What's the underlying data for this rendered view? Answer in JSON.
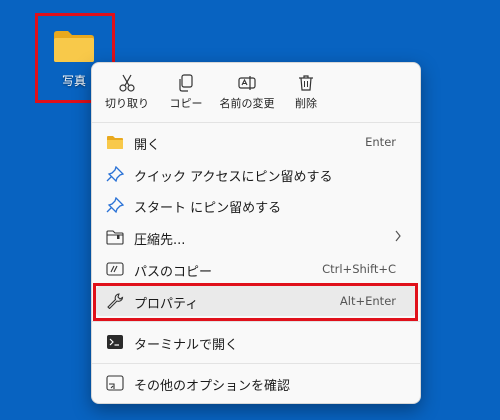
{
  "desktop": {
    "folder_label": "写真"
  },
  "quick_actions": {
    "cut": "切り取り",
    "copy": "コピー",
    "rename": "名前の変更",
    "delete": "削除"
  },
  "menu_items": [
    {
      "label": "開く",
      "shortcut": "Enter",
      "icon": "folder-icon"
    },
    {
      "label": "クイック アクセスにピン留めする",
      "shortcut": "",
      "icon": "pin-icon"
    },
    {
      "label": "スタート にピン留めする",
      "shortcut": "",
      "icon": "pin-icon"
    },
    {
      "label": "圧縮先...",
      "shortcut": "",
      "icon": "zip-folder-icon",
      "submenu": true
    },
    {
      "label": "パスのコピー",
      "shortcut": "Ctrl+Shift+C",
      "icon": "path-icon"
    },
    {
      "label": "プロパティ",
      "shortcut": "Alt+Enter",
      "icon": "wrench-icon"
    },
    {
      "label": "ターミナルで開く",
      "shortcut": "",
      "icon": "terminal-icon"
    },
    {
      "label": "その他のオプションを確認",
      "shortcut": "",
      "icon": "more-options-icon"
    }
  ],
  "colors": {
    "desktop_bg": "#0863c1",
    "highlight": "#e0101a",
    "pin_blue": "#2a72d6",
    "folder_yellow": "#f6c443"
  }
}
